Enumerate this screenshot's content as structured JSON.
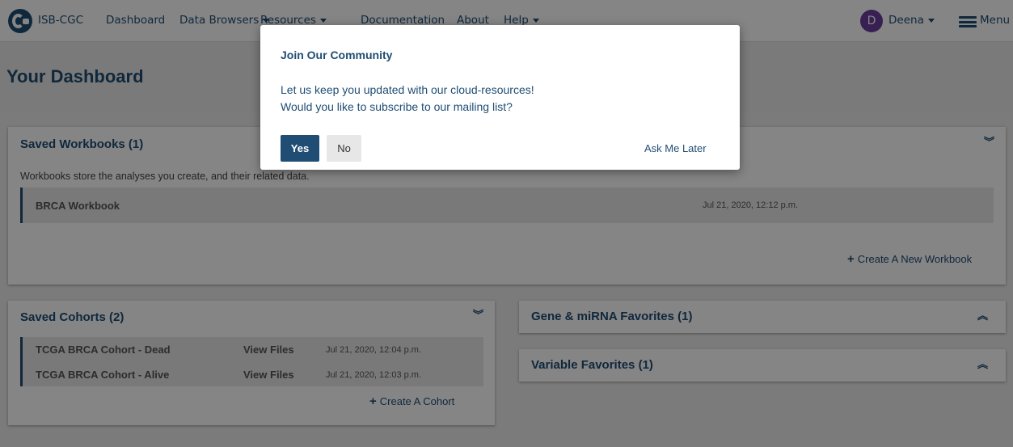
{
  "nav": {
    "brand": "ISB-CGC",
    "dashboard": "Dashboard",
    "data_browsers": "Data Browsers",
    "resources": "Resources",
    "documentation": "Documentation",
    "about": "About",
    "help": "Help",
    "user_initial": "D",
    "user_name": "Deena",
    "menu": "Menu"
  },
  "page": {
    "title": "Your Dashboard"
  },
  "workbooks": {
    "heading": "Saved Workbooks (1)",
    "description": "Workbooks store the analyses you create, and their related data.",
    "items": [
      {
        "name": "BRCA Workbook",
        "date": "Jul 21, 2020, 12:12 p.m."
      }
    ],
    "create_label": "Create A New Workbook"
  },
  "cohorts": {
    "heading": "Saved Cohorts (2)",
    "items": [
      {
        "name": "TCGA BRCA Cohort - Dead",
        "action": "View Files",
        "date": "Jul 21, 2020, 12:04 p.m."
      },
      {
        "name": "TCGA BRCA Cohort - Alive",
        "action": "View Files",
        "date": "Jul 21, 2020, 12:03 p.m."
      }
    ],
    "create_label": "Create A Cohort"
  },
  "gene_favorites": {
    "heading": "Gene & miRNA Favorites (1)"
  },
  "variable_favorites": {
    "heading": "Variable Favorites (1)"
  },
  "modal": {
    "title": "Join Our Community",
    "line1": "Let us keep you updated with our cloud-resources!",
    "line2": "Would you like to subscribe to our mailing list?",
    "yes": "Yes",
    "no": "No",
    "later": "Ask Me Later"
  },
  "icons": {
    "chevron_down": "chevrons-down-icon",
    "chevron_up": "chevrons-up-icon",
    "plus": "plus-icon",
    "menu": "hamburger-icon"
  },
  "colors": {
    "brand": "#1f4d74",
    "avatar": "#6b3fa0",
    "background": "#ebebeb",
    "row": "#e9e9e9"
  }
}
